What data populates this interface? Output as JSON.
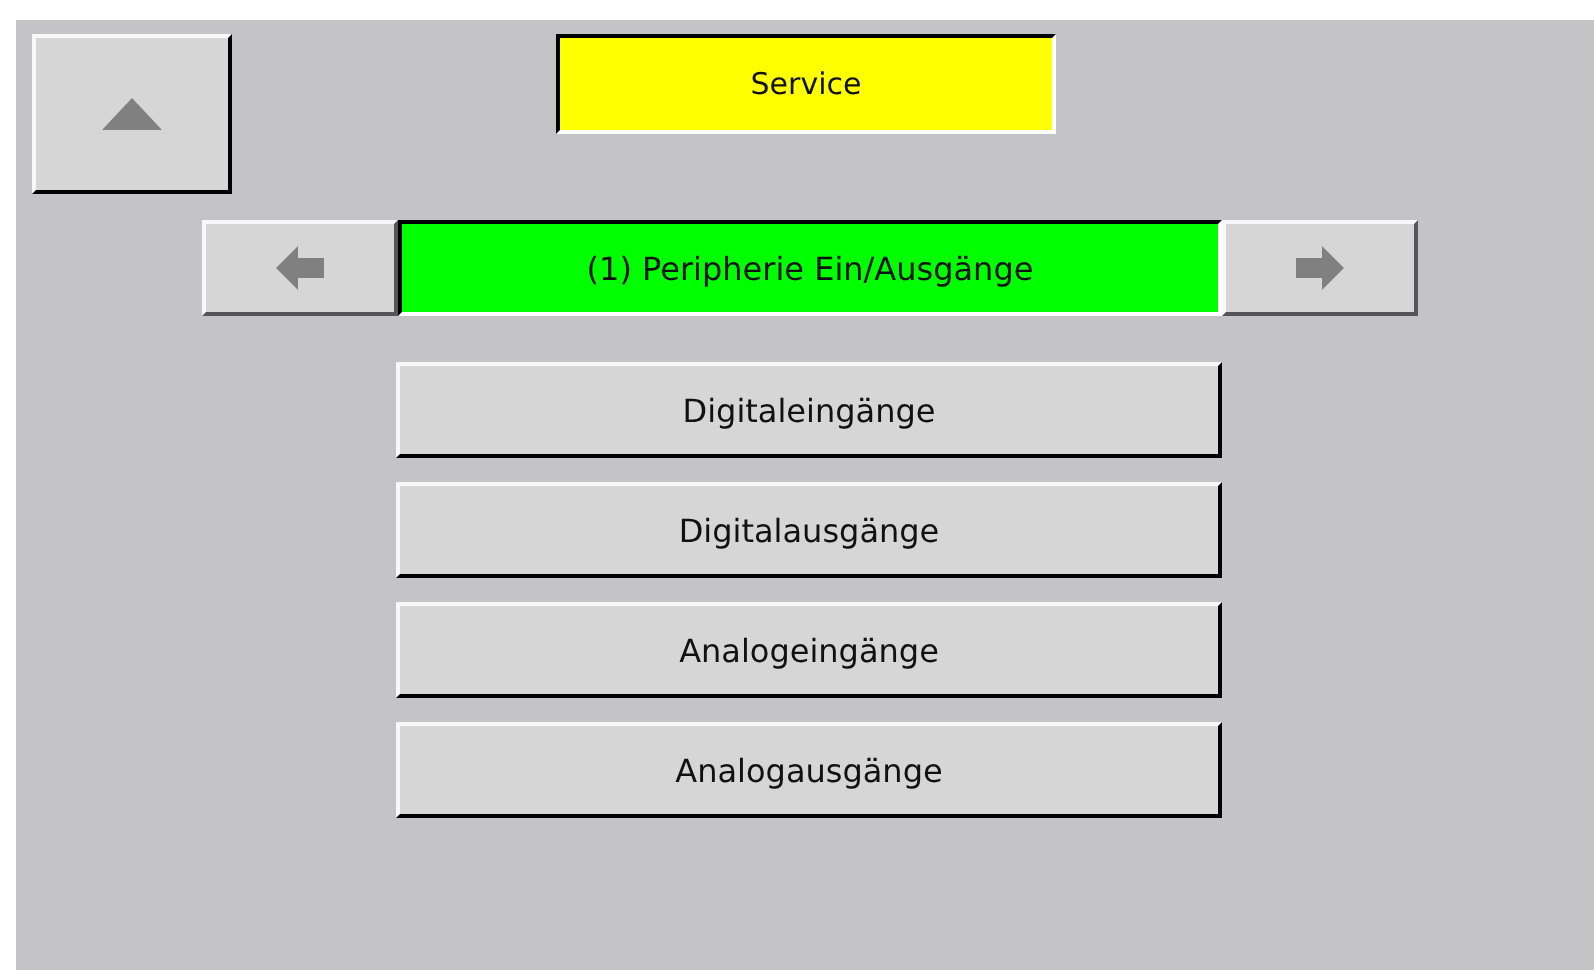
{
  "header": {
    "title": "Service"
  },
  "navigator": {
    "label": "(1) Peripherie Ein/Ausgänge"
  },
  "menu": [
    {
      "label": "Digitaleingänge"
    },
    {
      "label": "Digitalausgänge"
    },
    {
      "label": "Analogeingänge"
    },
    {
      "label": "Analogausgänge"
    }
  ]
}
